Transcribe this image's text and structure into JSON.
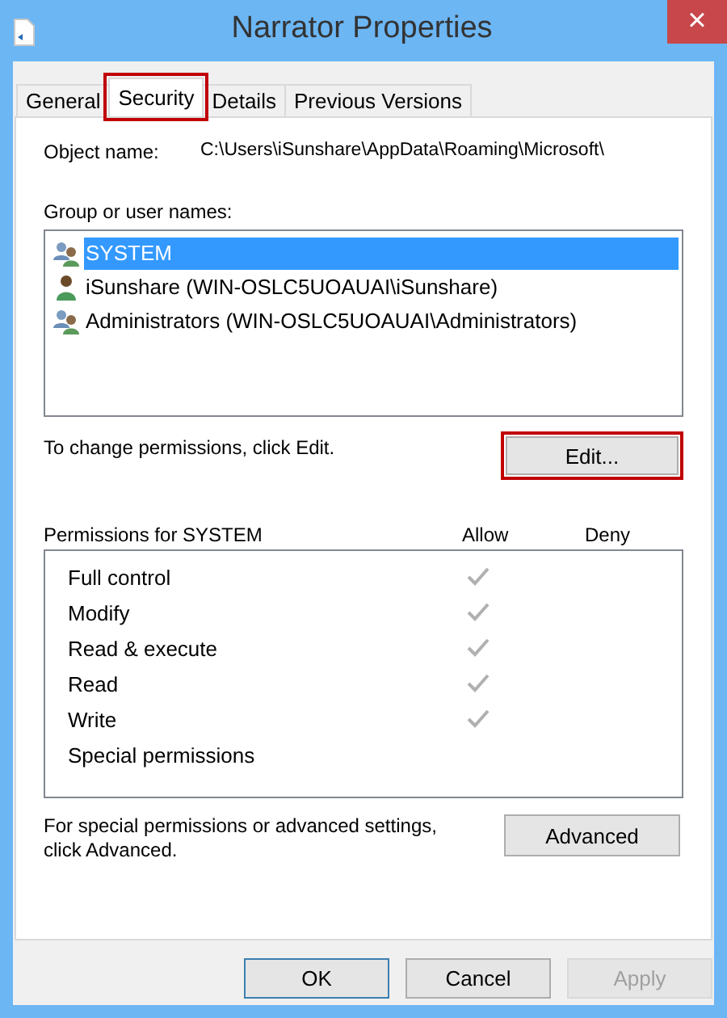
{
  "window": {
    "title": "Narrator Properties",
    "close": "×"
  },
  "tabs": [
    {
      "label": "General",
      "selected": false,
      "highlighted": false
    },
    {
      "label": "Security",
      "selected": true,
      "highlighted": true
    },
    {
      "label": "Details",
      "selected": false,
      "highlighted": false
    },
    {
      "label": "Previous Versions",
      "selected": false,
      "highlighted": false
    }
  ],
  "object_name": {
    "label": "Object name:",
    "value": "C:\\Users\\iSunshare\\AppData\\Roaming\\Microsoft\\"
  },
  "groups": {
    "label": "Group or user names:",
    "items": [
      {
        "name": "SYSTEM",
        "kind": "group",
        "selected": true
      },
      {
        "name": "iSunshare (WIN-OSLC5UOAUAI\\iSunshare)",
        "kind": "user",
        "selected": false
      },
      {
        "name": "Administrators (WIN-OSLC5UOAUAI\\Administrators)",
        "kind": "group",
        "selected": false
      }
    ]
  },
  "change_hint": "To change permissions, click Edit.",
  "edit_button": {
    "label": "Edit...",
    "highlighted": true
  },
  "permissions": {
    "label": "Permissions for SYSTEM",
    "allow_header": "Allow",
    "deny_header": "Deny",
    "rows": [
      {
        "name": "Full control",
        "allow": true,
        "deny": false
      },
      {
        "name": "Modify",
        "allow": true,
        "deny": false
      },
      {
        "name": "Read & execute",
        "allow": true,
        "deny": false
      },
      {
        "name": "Read",
        "allow": true,
        "deny": false
      },
      {
        "name": "Write",
        "allow": true,
        "deny": false
      },
      {
        "name": "Special permissions",
        "allow": false,
        "deny": false
      }
    ]
  },
  "advanced_hint": "For special permissions or advanced settings, click Advanced.",
  "advanced_button": {
    "label": "Advanced"
  },
  "buttons": [
    {
      "label": "OK",
      "kind": "default",
      "disabled": false
    },
    {
      "label": "Cancel",
      "kind": "normal",
      "disabled": false
    },
    {
      "label": "Apply",
      "kind": "normal",
      "disabled": true
    }
  ]
}
